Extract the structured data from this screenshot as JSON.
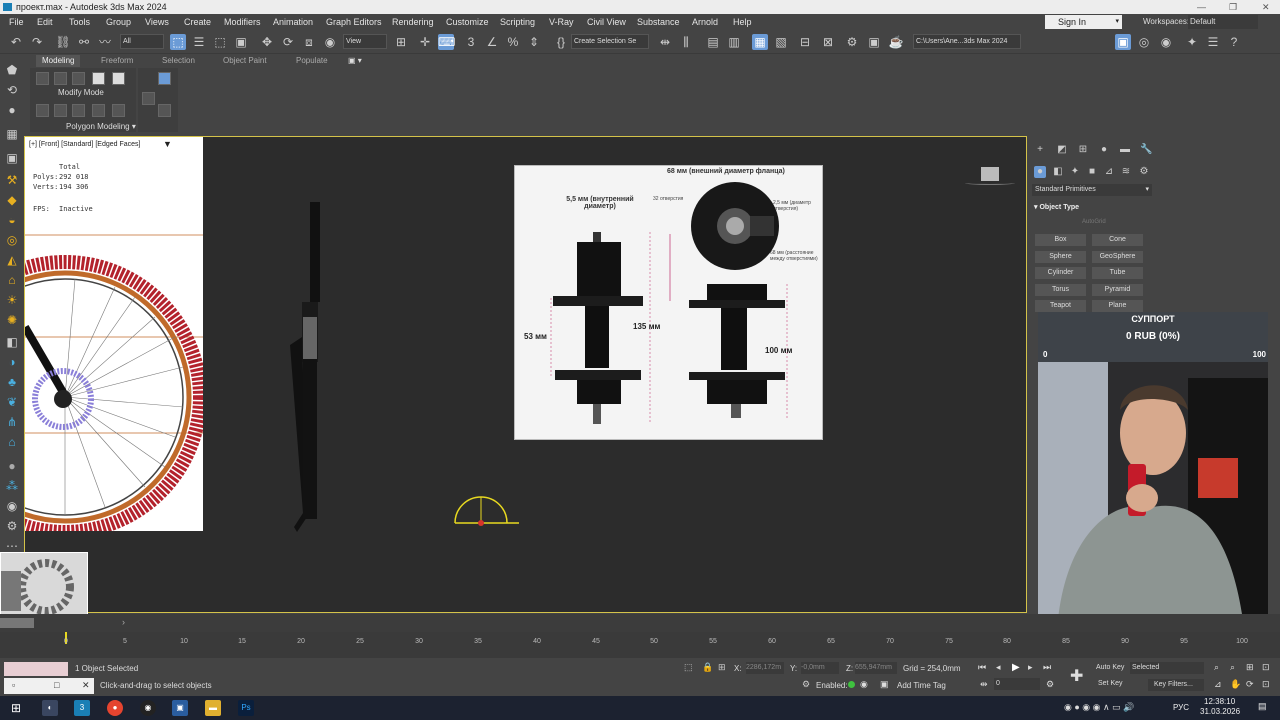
{
  "window": {
    "title": "проект.max - Autodesk 3ds Max 2024",
    "controls": [
      "—",
      "❐",
      "✕"
    ]
  },
  "menu": {
    "items": [
      "File",
      "Edit",
      "Tools",
      "Group",
      "Views",
      "Create",
      "Modifiers",
      "Animation",
      "Graph Editors",
      "Rendering",
      "Customize",
      "Scripting",
      "V-Ray",
      "Civil View",
      "Substance",
      "Arnold",
      "Help"
    ],
    "sign_in": "Sign In",
    "workspaces_label": "Workspaces:",
    "workspace_value": "Default"
  },
  "toolbar": {
    "filter_value": "All",
    "view_value": "View",
    "selection_set_value": "Create Selection Se",
    "path_value": "C:\\Users\\Ane...3ds Max 2024"
  },
  "ribbon": {
    "tabs": [
      "Modeling",
      "Freeform",
      "Selection",
      "Object Paint",
      "Populate"
    ],
    "modify_mode": "Modify Mode",
    "polygon_modeling": "Polygon Modeling"
  },
  "viewport": {
    "label": "[+] [Front] [Standard] [Edged Faces]",
    "stats_total": "Total",
    "stats_polys_label": "Polys:",
    "stats_polys_value": "292 018",
    "stats_verts_label": "Verts:",
    "stats_verts_value": "194 306",
    "fps_label": "FPS:",
    "fps_value": "Inactive"
  },
  "reference_image": {
    "top_caption": "68 мм (внешний диаметр фланца)",
    "inner_diameter": "5,5 мм (внутренний диаметр)",
    "holes_count": "32 отверстия",
    "hole_diameter": "2,5 мм (диаметр отверстия)",
    "hole_distance": "68 мм (расстояние между отверстиями)",
    "dim_53": "53 мм",
    "dim_135": "135 мм",
    "dim_100": "100 мм",
    "brand": "ARMOUR"
  },
  "command_panel": {
    "category": "Standard Primitives",
    "object_type_title": "Object Type",
    "autogrid": "AutoGrid",
    "buttons": [
      "Box",
      "Cone",
      "Sphere",
      "GeoSphere",
      "Cylinder",
      "Tube",
      "Torus",
      "Pyramid",
      "Teapot",
      "Plane"
    ]
  },
  "support_overlay": {
    "title": "СУППОРТ",
    "amount": "0 RUB (0%)",
    "min": "0",
    "max": "100"
  },
  "timeline": {
    "slider_value": "0 / 100",
    "ticks": [
      "0",
      "5",
      "10",
      "15",
      "20",
      "25",
      "30",
      "35",
      "40",
      "45",
      "50",
      "55",
      "60",
      "65",
      "70",
      "75",
      "80",
      "85",
      "90",
      "95",
      "100"
    ]
  },
  "status": {
    "selected_text": "1 Object Selected",
    "prompt_text": "Click-and-drag to select objects",
    "x_label": "X:",
    "x_value": "2286,172m",
    "y_label": "Y:",
    "y_value": "-0,0mm",
    "z_label": "Z:",
    "z_value": "655,947mm",
    "grid_text": "Grid = 254,0mm",
    "enabled_label": "Enabled:",
    "add_time_tag": "Add Time Tag",
    "auto_key": "Auto Key",
    "selected_dd": "Selected",
    "set_key": "Set Key",
    "key_filters": "Key Filters...",
    "frame_value": "0"
  },
  "taskbar": {
    "lang": "РУС",
    "time": "12:38:10",
    "date": "31.03.2026"
  },
  "colors": {
    "accent_blue": "#6b9bd6",
    "viewport_border": "#d4c34a",
    "tire_red": "#b3222c",
    "rim_orange": "#c06a2a"
  }
}
